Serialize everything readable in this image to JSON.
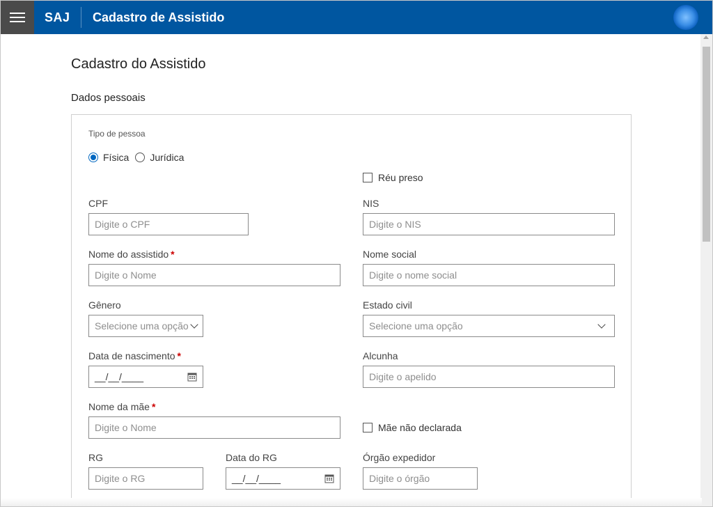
{
  "header": {
    "brand": "SAJ",
    "title": "Cadastro de Assistido"
  },
  "page": {
    "title": "Cadastro do Assistido",
    "section": "Dados pessoais"
  },
  "form": {
    "tipo_pessoa_label": "Tipo de pessoa",
    "tipo_pessoa_options": [
      "Física",
      "Jurídica"
    ],
    "tipo_pessoa_selected": "Física",
    "reu_preso_label": "Réu preso",
    "cpf_label": "CPF",
    "cpf_placeholder": "Digite o CPF",
    "nis_label": "NIS",
    "nis_placeholder": "Digite o NIS",
    "nome_label": "Nome do assistido",
    "nome_placeholder": "Digite o Nome",
    "nome_social_label": "Nome social",
    "nome_social_placeholder": "Digite o nome social",
    "genero_label": "Gênero",
    "genero_value": "Selecione uma opção",
    "estado_civil_label": "Estado civil",
    "estado_civil_value": "Selecione uma opção",
    "nascimento_label": "Data de nascimento",
    "nascimento_value": "__/__/____",
    "alcunha_label": "Alcunha",
    "alcunha_placeholder": "Digite o apelido",
    "mae_label": "Nome da mãe",
    "mae_placeholder": "Digite o Nome",
    "mae_nao_declarada_label": "Mãe não declarada",
    "rg_label": "RG",
    "rg_placeholder": "Digite o RG",
    "data_rg_label": "Data do RG",
    "data_rg_value": "__/__/____",
    "orgao_label": "Órgão expedidor",
    "orgao_placeholder": "Digite o órgão",
    "required_marker": "*"
  },
  "colors": {
    "header_bg": "#0056a0",
    "hamburger_bg": "#4a4a4a",
    "radio_accent": "#0067c0",
    "required": "#cc0000"
  }
}
